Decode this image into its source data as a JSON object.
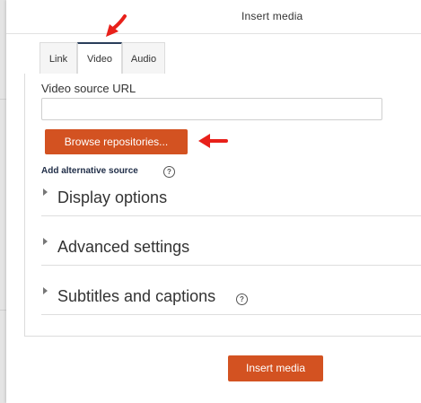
{
  "dialog": {
    "title": "Insert media"
  },
  "tabs": [
    {
      "label": "Link"
    },
    {
      "label": "Video"
    },
    {
      "label": "Audio"
    }
  ],
  "video": {
    "source_url_label": "Video source URL",
    "source_url_value": "",
    "browse_label": "Browse repositories...",
    "add_alternative_label": "Add alternative source"
  },
  "sections": [
    {
      "label": "Display options"
    },
    {
      "label": "Advanced settings"
    },
    {
      "label": "Subtitles and captions"
    }
  ],
  "icons": {
    "help": "?"
  },
  "footer": {
    "insert_label": "Insert media"
  },
  "colors": {
    "accent": "#d35221",
    "annotation_arrow": "#e8201a",
    "active_tab_border": "#2a3e5a"
  }
}
